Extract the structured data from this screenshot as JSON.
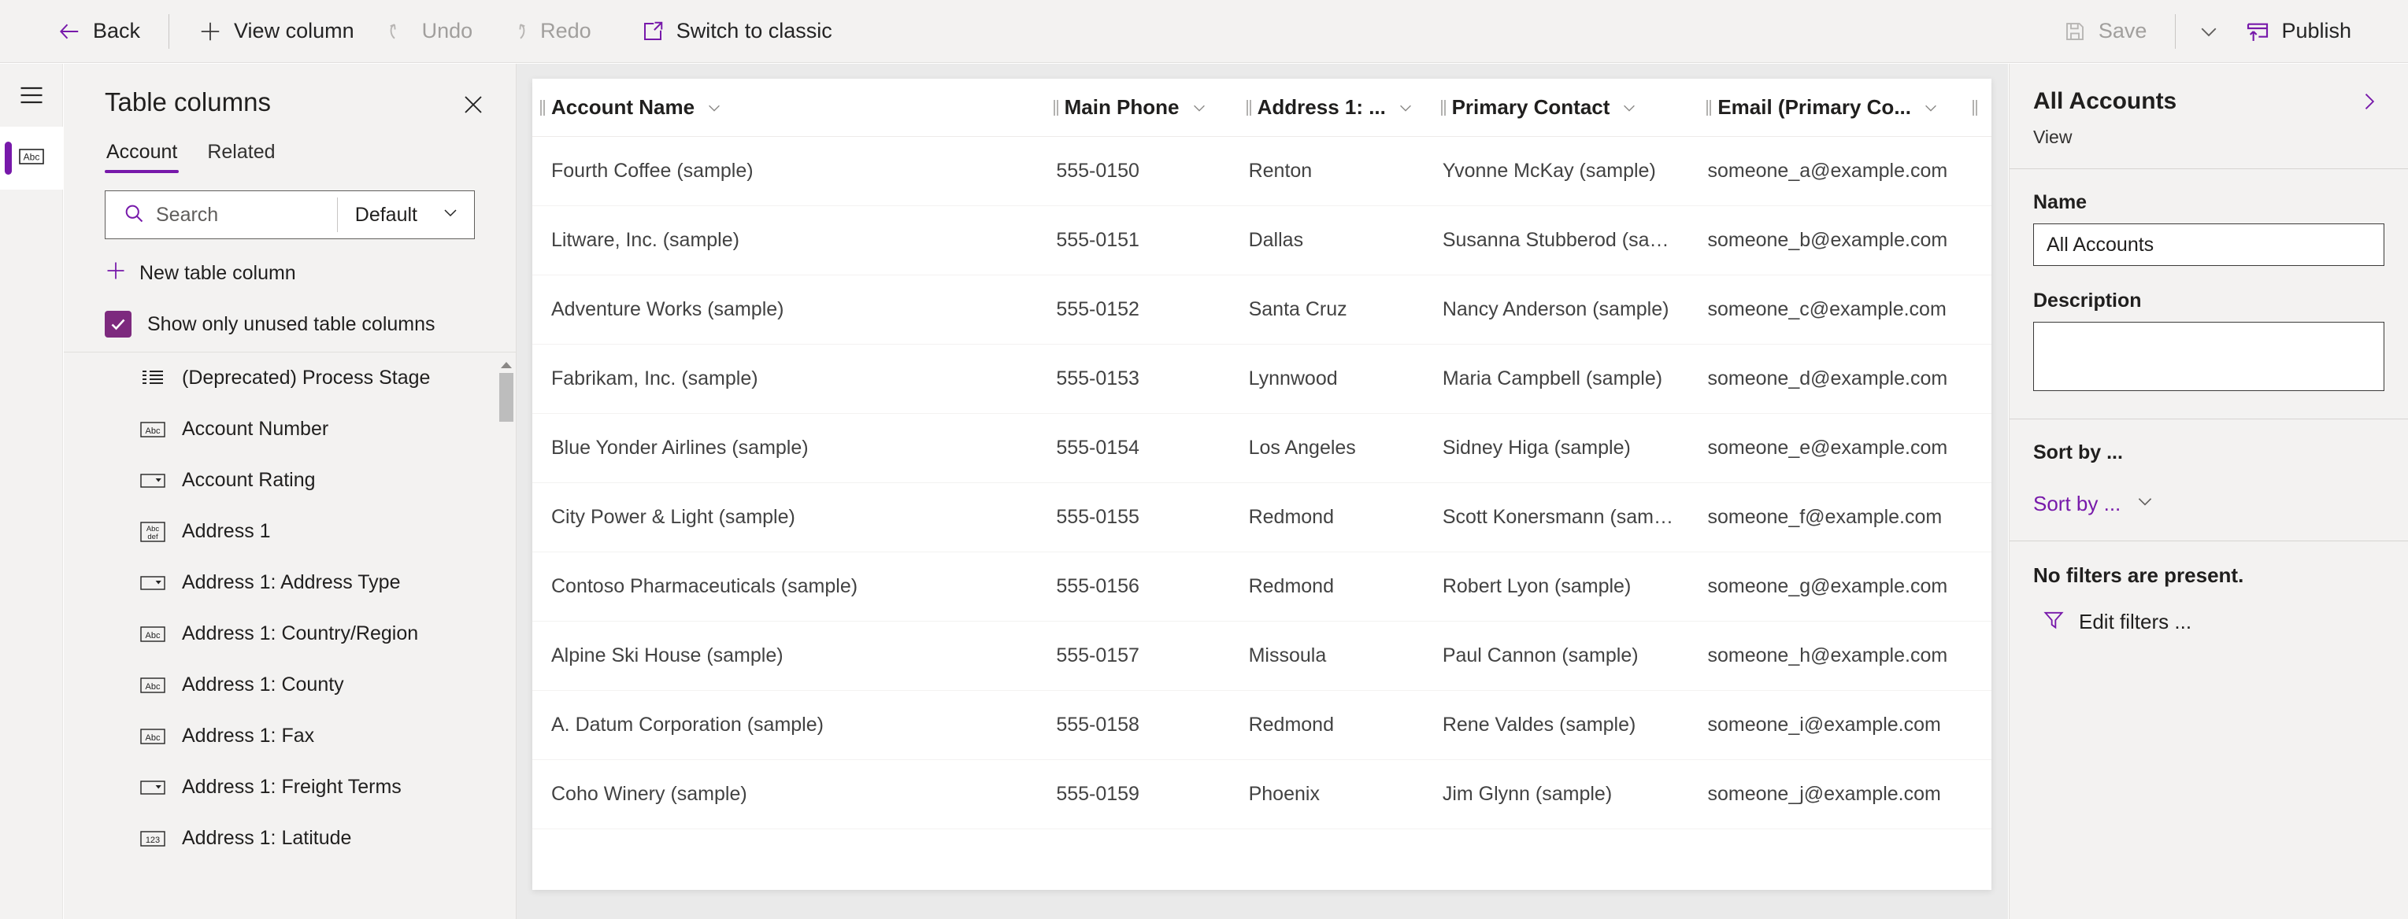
{
  "theme": {
    "accent": "#7719aa",
    "checkbox_fill": "#7d2a7e",
    "panel_bg": "#f3f2f1",
    "canvas_bg": "#eaeaea"
  },
  "commandbar": {
    "left_items": [
      {
        "label": "Back",
        "icon": "arrow-left-icon",
        "disabled": false
      },
      {
        "label": "View column",
        "icon": "plus-icon",
        "disabled": false
      },
      {
        "label": "Undo",
        "icon": "undo-icon",
        "disabled": true
      },
      {
        "label": "Redo",
        "icon": "redo-icon",
        "disabled": true
      },
      {
        "label": "Switch to classic",
        "icon": "open-in-new-icon",
        "disabled": false
      }
    ],
    "right_items": [
      {
        "label": "Save",
        "icon": "save-icon",
        "disabled": true
      },
      {
        "label": "Publish",
        "icon": "publish-icon",
        "disabled": false
      }
    ],
    "chevron_icon": "chevron-down-icon"
  },
  "rail": {
    "hamburger_icon": "hamburger-menu-icon",
    "items": [
      {
        "icon": "abc-text-icon",
        "selected": true
      }
    ]
  },
  "panel": {
    "title": "Table columns",
    "close_icon": "close-icon",
    "tabs": [
      {
        "label": "Account",
        "active": true
      },
      {
        "label": "Related",
        "active": false
      }
    ],
    "search": {
      "placeholder": "Search",
      "value": "",
      "icon": "search-icon"
    },
    "filter_select": {
      "value": "Default",
      "icon": "chevron-down-icon"
    },
    "new_column": {
      "label": "New table column",
      "icon": "plus-icon"
    },
    "show_unused": {
      "label": "Show only unused table columns",
      "checked": true,
      "icon": "check-icon"
    },
    "columns": [
      {
        "label": "(Deprecated) Process Stage",
        "icon": "list-lines-icon"
      },
      {
        "label": "Account Number",
        "icon": "abc-text-icon"
      },
      {
        "label": "Account Rating",
        "icon": "dropdown-choice-icon"
      },
      {
        "label": "Address 1",
        "icon": "abc-def-multiline-icon"
      },
      {
        "label": "Address 1: Address Type",
        "icon": "dropdown-choice-icon"
      },
      {
        "label": "Address 1: Country/Region",
        "icon": "abc-text-icon"
      },
      {
        "label": "Address 1: County",
        "icon": "abc-text-icon"
      },
      {
        "label": "Address 1: Fax",
        "icon": "abc-text-icon"
      },
      {
        "label": "Address 1: Freight Terms",
        "icon": "dropdown-choice-icon"
      },
      {
        "label": "Address 1: Latitude",
        "icon": "number-123-icon"
      }
    ],
    "scrollbar": {
      "up_arrow_icon": "caret-up-icon"
    }
  },
  "grid": {
    "columns": [
      {
        "label": "Account Name",
        "key": "account_name",
        "menu_icon": "chevron-down-icon"
      },
      {
        "label": "Main Phone",
        "key": "main_phone",
        "menu_icon": "chevron-down-icon"
      },
      {
        "label": "Address 1: ...",
        "key": "address1_city",
        "menu_icon": "chevron-down-icon"
      },
      {
        "label": "Primary Contact",
        "key": "primary_contact",
        "menu_icon": "chevron-down-icon"
      },
      {
        "label": "Email (Primary Co...",
        "key": "email_primary_contact",
        "menu_icon": "chevron-down-icon"
      }
    ],
    "rows": [
      {
        "account_name": "Fourth Coffee (sample)",
        "main_phone": "555-0150",
        "address1_city": "Renton",
        "primary_contact": "Yvonne McKay (sample)",
        "email_primary_contact": "someone_a@example.com"
      },
      {
        "account_name": "Litware, Inc. (sample)",
        "main_phone": "555-0151",
        "address1_city": "Dallas",
        "primary_contact": "Susanna Stubberod (samp...",
        "email_primary_contact": "someone_b@example.com"
      },
      {
        "account_name": "Adventure Works (sample)",
        "main_phone": "555-0152",
        "address1_city": "Santa Cruz",
        "primary_contact": "Nancy Anderson (sample)",
        "email_primary_contact": "someone_c@example.com"
      },
      {
        "account_name": "Fabrikam, Inc. (sample)",
        "main_phone": "555-0153",
        "address1_city": "Lynnwood",
        "primary_contact": "Maria Campbell (sample)",
        "email_primary_contact": "someone_d@example.com"
      },
      {
        "account_name": "Blue Yonder Airlines (sample)",
        "main_phone": "555-0154",
        "address1_city": "Los Angeles",
        "primary_contact": "Sidney Higa (sample)",
        "email_primary_contact": "someone_e@example.com"
      },
      {
        "account_name": "City Power & Light (sample)",
        "main_phone": "555-0155",
        "address1_city": "Redmond",
        "primary_contact": "Scott Konersmann (sample)",
        "email_primary_contact": "someone_f@example.com"
      },
      {
        "account_name": "Contoso Pharmaceuticals (sample)",
        "main_phone": "555-0156",
        "address1_city": "Redmond",
        "primary_contact": "Robert Lyon (sample)",
        "email_primary_contact": "someone_g@example.com"
      },
      {
        "account_name": "Alpine Ski House (sample)",
        "main_phone": "555-0157",
        "address1_city": "Missoula",
        "primary_contact": "Paul Cannon (sample)",
        "email_primary_contact": "someone_h@example.com"
      },
      {
        "account_name": "A. Datum Corporation (sample)",
        "main_phone": "555-0158",
        "address1_city": "Redmond",
        "primary_contact": "Rene Valdes (sample)",
        "email_primary_contact": "someone_i@example.com"
      },
      {
        "account_name": "Coho Winery (sample)",
        "main_phone": "555-0159",
        "address1_city": "Phoenix",
        "primary_contact": "Jim Glynn (sample)",
        "email_primary_contact": "someone_j@example.com"
      }
    ]
  },
  "properties": {
    "title": "All Accounts",
    "subtitle": "View",
    "expand_icon": "chevron-right-icon",
    "name_label": "Name",
    "name_value": "All Accounts",
    "description_label": "Description",
    "description_value": "",
    "sort_heading": "Sort by ...",
    "sort_link": "Sort by ...",
    "sort_chevron_icon": "chevron-down-icon",
    "filters_text": "No filters are present.",
    "edit_filters_label": "Edit filters ...",
    "filter_icon": "funnel-icon"
  }
}
